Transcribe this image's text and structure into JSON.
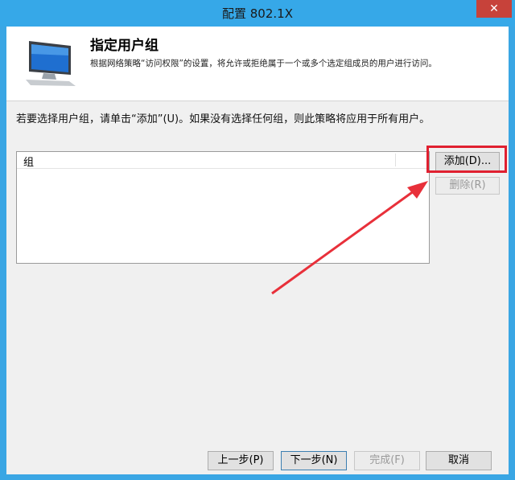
{
  "window": {
    "title": "配置 802.1X",
    "close_glyph": "✕"
  },
  "header": {
    "title": "指定用户组",
    "description": "根据网络策略“访问权限”的设置，将允许或拒绝属于一个或多个选定组成员的用户进行访问。"
  },
  "main": {
    "instruction": "若要选择用户组，请单击“添加”(U)。如果没有选择任何组，则此策略将应用于所有用户。",
    "list": {
      "columns": [
        "组"
      ],
      "rows": []
    },
    "add_label": "添加(D)...",
    "delete_label": "删除(R)"
  },
  "footer": {
    "back_label": "上一步(P)",
    "next_label": "下一步(N)",
    "finish_label": "完成(F)",
    "cancel_label": "取消"
  },
  "colors": {
    "titlebar": "#36a8e8",
    "highlight": "#e02030",
    "arrow": "#e8303a"
  },
  "icons": {
    "header": "computer-monitor-icon"
  }
}
